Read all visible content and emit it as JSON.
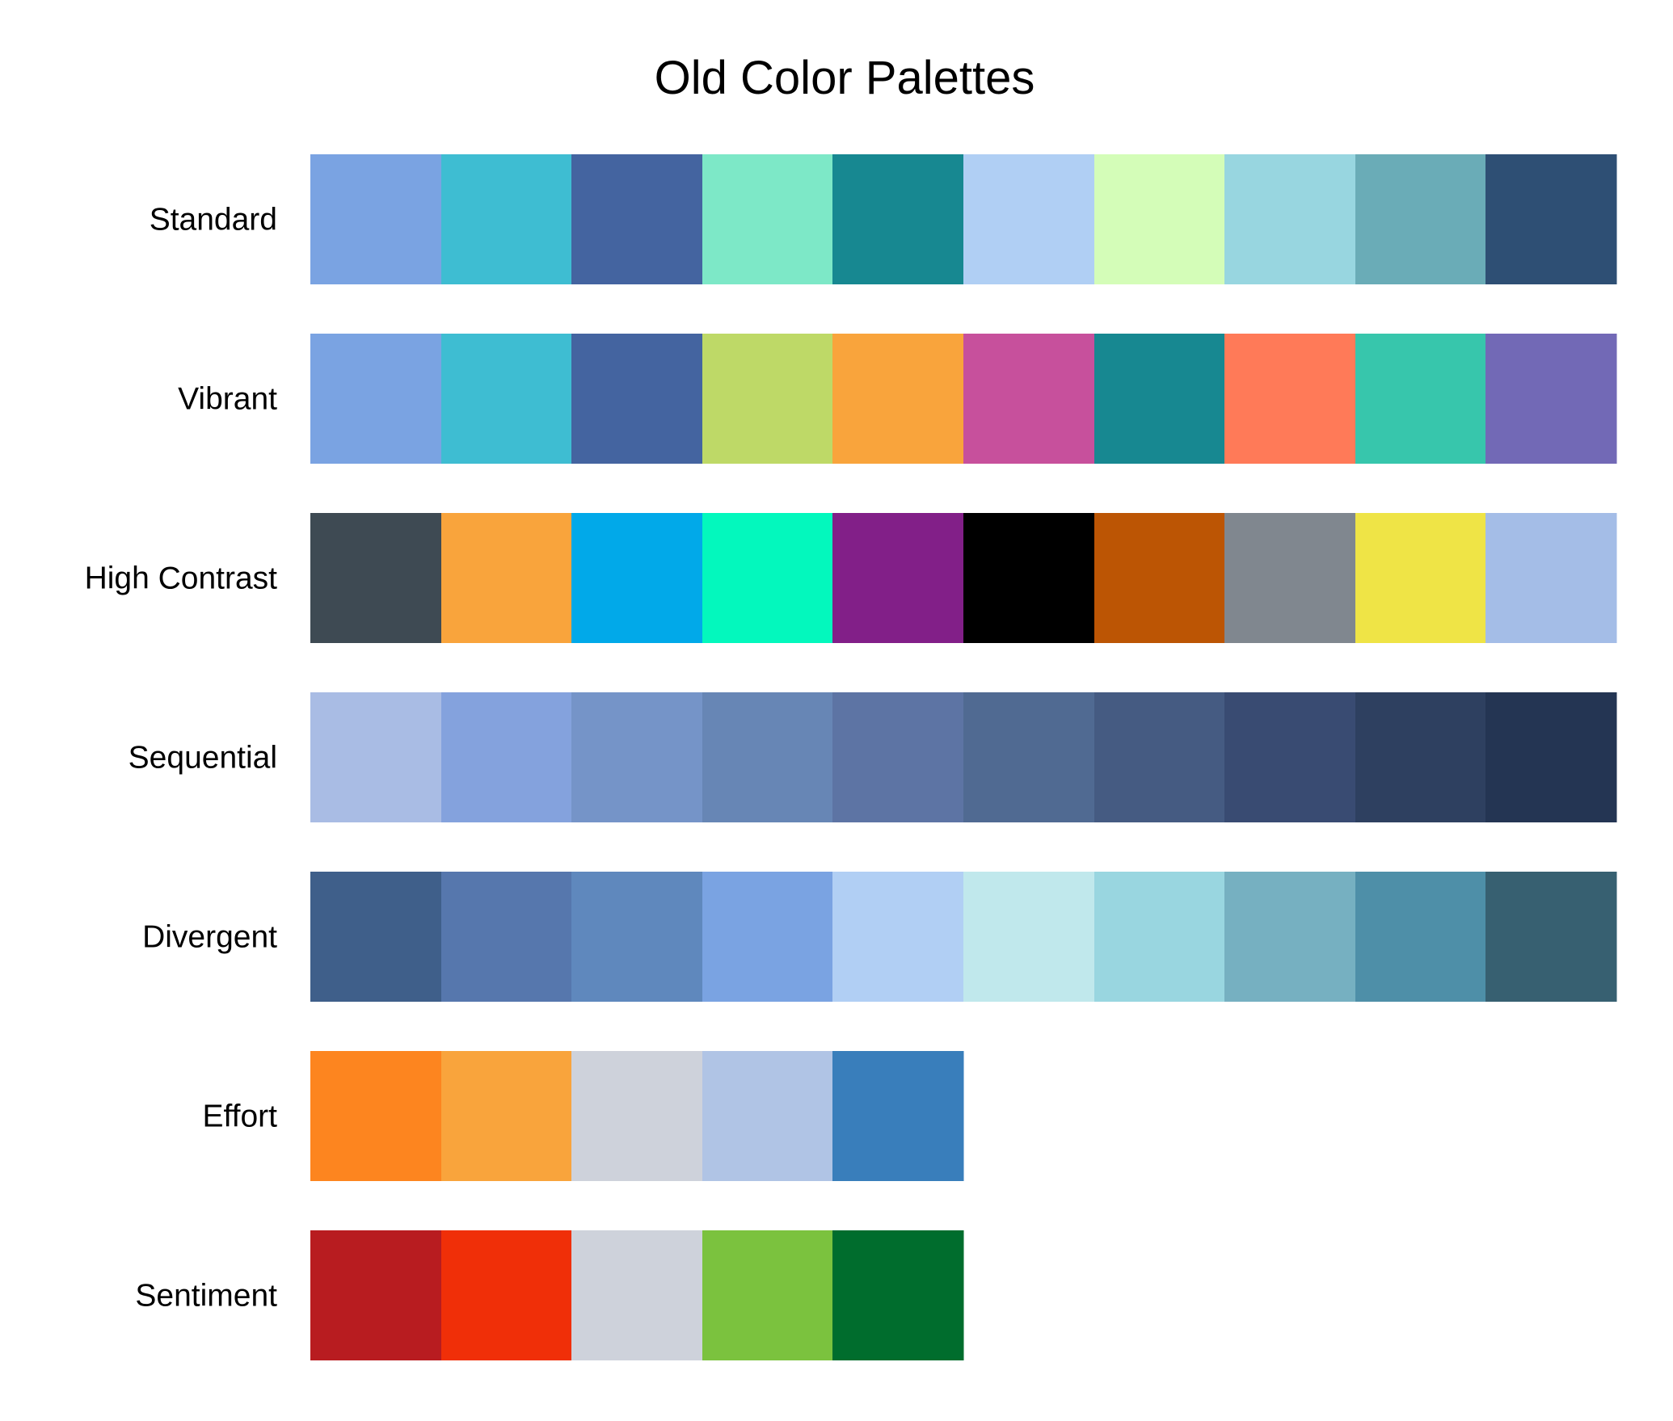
{
  "chart_data": {
    "type": "table",
    "title": "Old Color Palettes",
    "palettes": [
      {
        "name": "Standard",
        "colors": [
          "#7aa3e2",
          "#3ebdd2",
          "#4464a0",
          "#7de8c7",
          "#178891",
          "#b0cff4",
          "#d4fdb8",
          "#98d6e0",
          "#6aacb7",
          "#2e4f74"
        ]
      },
      {
        "name": "Vibrant",
        "colors": [
          "#7aa3e2",
          "#3ebdd2",
          "#4464a0",
          "#bed967",
          "#f9a43c",
          "#c7509c",
          "#178891",
          "#ff7a58",
          "#37c6ac",
          "#7269b6"
        ]
      },
      {
        "name": "High Contrast",
        "colors": [
          "#3e4a53",
          "#f9a43c",
          "#01a9e9",
          "#03f8bd",
          "#821f88",
          "#000000",
          "#bc5504",
          "#80878f",
          "#efe446",
          "#a4bde7"
        ]
      },
      {
        "name": "Sequential",
        "colors": [
          "#a9bce4",
          "#84a2dd",
          "#7594c8",
          "#6786b5",
          "#5d74a4",
          "#506a92",
          "#455b82",
          "#394b72",
          "#2e4060",
          "#243553"
        ]
      },
      {
        "name": "Divergent",
        "colors": [
          "#3f5f8a",
          "#5677ad",
          "#5f88bd",
          "#7aa3e2",
          "#b1cff4",
          "#c0e8ec",
          "#99d6e0",
          "#76b0c1",
          "#4e8fa8",
          "#376071"
        ]
      },
      {
        "name": "Effort",
        "colors": [
          "#fd851f",
          "#f9a43c",
          "#ced2db",
          "#b0c4e5",
          "#397ebb"
        ]
      },
      {
        "name": "Sentiment",
        "colors": [
          "#b81c20",
          "#f02f08",
          "#ced2db",
          "#7bc23e",
          "#006d2d"
        ]
      }
    ]
  }
}
